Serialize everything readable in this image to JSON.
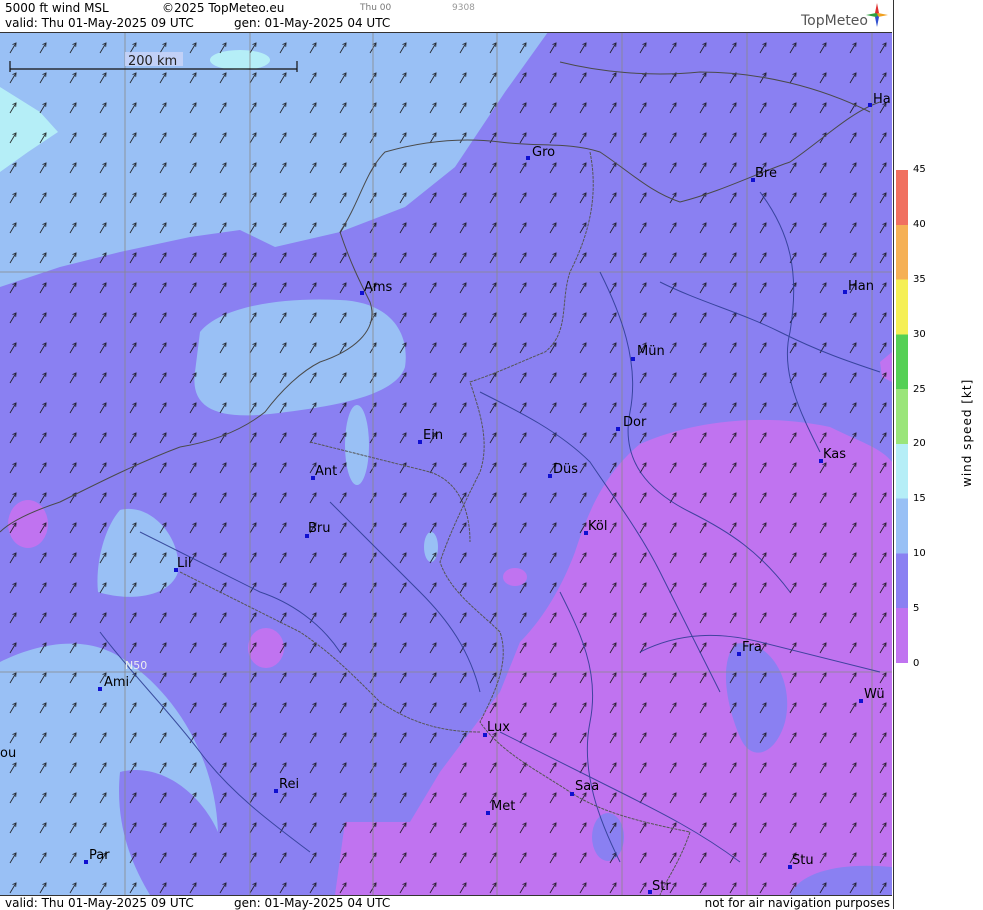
{
  "header": {
    "product": "5000 ft wind MSL",
    "copyright": "©2025 TopMeteo.eu",
    "day_marker": "Thu 00",
    "code": "9308",
    "valid": "valid:  Thu  01-May-2025  09 UTC",
    "generated": "gen: 01-May-2025 04 UTC",
    "logo": "TopMeteo"
  },
  "footer": {
    "valid": "valid:  Thu  01-May-2025  09 UTC",
    "generated": "gen: 01-May-2025 04 UTC",
    "disclaimer": "not for air navigation purposes"
  },
  "map": {
    "scale_label": "200 km",
    "grid_label": "N50",
    "cities": [
      {
        "label": "Gro"
      },
      {
        "label": "Bre"
      },
      {
        "label": "Ha"
      },
      {
        "label": "Ams"
      },
      {
        "label": "Han"
      },
      {
        "label": "Mün"
      },
      {
        "label": "Ein"
      },
      {
        "label": "Dor"
      },
      {
        "label": "Ant"
      },
      {
        "label": "Düs"
      },
      {
        "label": "Kas"
      },
      {
        "label": "Bru"
      },
      {
        "label": "Köl"
      },
      {
        "label": "Lil"
      },
      {
        "label": "Fra"
      },
      {
        "label": "Ami"
      },
      {
        "label": "Wü"
      },
      {
        "label": "Lux"
      },
      {
        "label": "Rei"
      },
      {
        "label": "Saa"
      },
      {
        "label": "Met"
      },
      {
        "label": "Par"
      },
      {
        "label": "Stu"
      },
      {
        "label": "Str"
      },
      {
        "label": "ou"
      }
    ]
  },
  "legend": {
    "title": "wind speed [kt]",
    "ticks": [
      "45",
      "40",
      "35",
      "30",
      "25",
      "20",
      "15",
      "10",
      "5",
      "0"
    ],
    "colors": [
      "#c073f0",
      "#8a80f2",
      "#99c0f5",
      "#b5eef7",
      "#9ae57a",
      "#55d055",
      "#f5ef55",
      "#f5b055",
      "#f07060"
    ]
  }
}
